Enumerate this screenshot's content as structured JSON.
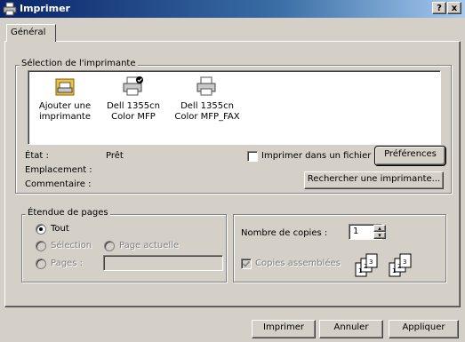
{
  "window": {
    "title": "Imprimer",
    "help_button": "?",
    "close_button": "x"
  },
  "tabs": [
    {
      "label": "Général",
      "active": true
    }
  ],
  "printer_selection": {
    "legend": "Sélection de l'imprimante",
    "printers": [
      {
        "label_line1": "Ajouter une",
        "label_line2": "imprimante",
        "icon": "add-printer-icon"
      },
      {
        "label_line1": "Dell 1355cn",
        "label_line2": "Color MFP",
        "icon": "printer-icon",
        "default": true
      },
      {
        "label_line1": "Dell 1355cn",
        "label_line2": "Color MFP_FAX",
        "icon": "printer-icon"
      }
    ],
    "status_label": "État :",
    "status_value": "Prêt",
    "location_label": "Emplacement :",
    "comment_label": "Commentaire :",
    "print_to_file": "Imprimer dans un fichier",
    "print_to_file_checked": false,
    "preferences_button": "Préférences",
    "find_printer_button": "Rechercher une imprimante..."
  },
  "page_range": {
    "legend": "Étendue de pages",
    "all": "Tout",
    "selection": "Sélection",
    "current_page": "Page actuelle",
    "pages": "Pages :",
    "pages_value": "",
    "selected": "Tout"
  },
  "copies": {
    "label": "Nombre de copies :",
    "value": "1",
    "collate": "Copies assemblées",
    "collate_checked": true
  },
  "footer": {
    "print_button": "Imprimer",
    "cancel_button": "Annuler",
    "apply_button": "Appliquer"
  }
}
